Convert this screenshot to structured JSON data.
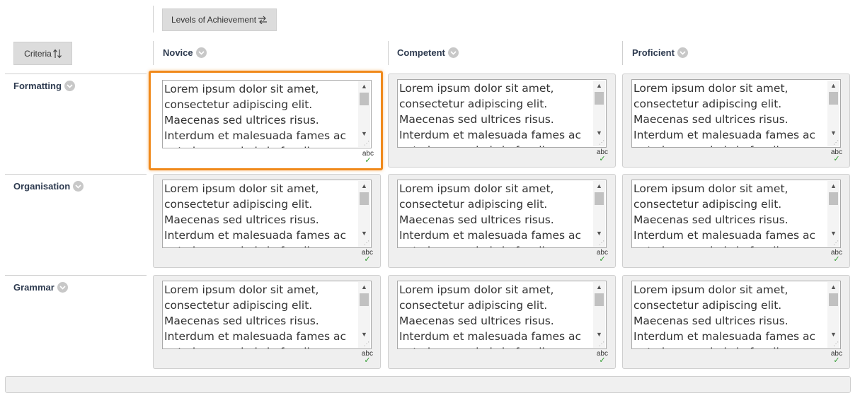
{
  "toolbar": {
    "levels_label": "Levels of Achievement",
    "levels_icon": "swap-arrows-icon",
    "criteria_label": "Criteria",
    "criteria_icon": "sort-arrows-icon"
  },
  "columns": [
    {
      "label": "Novice"
    },
    {
      "label": "Competent"
    },
    {
      "label": "Proficient"
    }
  ],
  "rows": [
    {
      "label": "Formatting"
    },
    {
      "label": "Organisation"
    },
    {
      "label": "Grammar"
    }
  ],
  "cell_text": "Lorem ipsum dolor sit amet,\nconsectetur adipiscing elit.\nMaecenas sed ultrices risus.\nInterdum et malesuada fames ac\nante ipsum primis in faucibus. Fusce",
  "spell_label": "abc",
  "selected_cell": {
    "row": 0,
    "column": 0
  },
  "colors": {
    "highlight": "#f08a1c",
    "spell_check": "#2f9b2f",
    "header_text": "#2d3a4f"
  }
}
